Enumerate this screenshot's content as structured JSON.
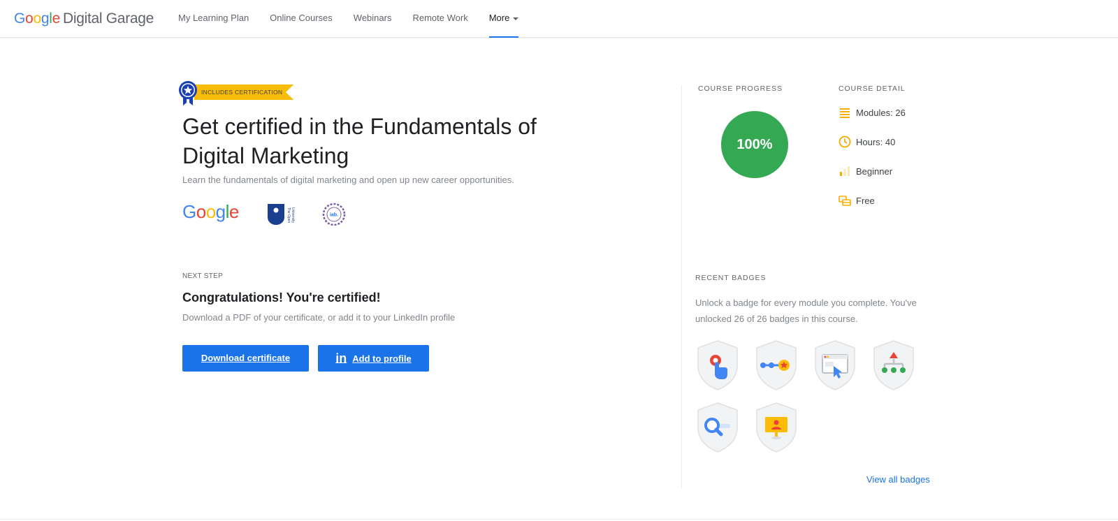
{
  "header": {
    "logo_google": "Google",
    "logo_rest": "Digital Garage",
    "nav": [
      {
        "label": "My Learning Plan"
      },
      {
        "label": "Online Courses"
      },
      {
        "label": "Webinars"
      },
      {
        "label": "Remote Work"
      },
      {
        "label": "More"
      }
    ]
  },
  "course": {
    "certification_ribbon": "INCLUDES CERTIFICATION",
    "title": "Get certified in the Fundamentals of Digital Marketing",
    "subtitle": "Learn the fundamentals of digital marketing and open up new career opportunities.",
    "partners": {
      "google": "Google",
      "open_university": "The Open University",
      "iab": "iab."
    }
  },
  "next_step": {
    "label": "NEXT STEP",
    "heading": "Congratulations! You're certified!",
    "description": "Download a PDF of your certificate, or add it to your LinkedIn profile",
    "download_button": "Download certificate",
    "profile_button_icon": "in",
    "profile_button": "Add to profile"
  },
  "progress": {
    "label": "COURSE PROGRESS",
    "value_text": "100%",
    "value": 100,
    "color": "#34a853"
  },
  "details": {
    "label": "COURSE DETAIL",
    "modules": "Modules: 26",
    "hours": "Hours: 40",
    "level": "Beginner",
    "price": "Free",
    "icon_color": "#f9ab00"
  },
  "badges": {
    "label": "RECENT BADGES",
    "description": "Unlock a badge for every module you complete. You've unlocked 26 of 26 badges in this course.",
    "view_all": "View all badges",
    "items": [
      {
        "icon": "pointer-click-badge-icon"
      },
      {
        "icon": "path-star-badge-icon"
      },
      {
        "icon": "browser-cursor-badge-icon"
      },
      {
        "icon": "hierarchy-badge-icon"
      },
      {
        "icon": "search-badge-icon"
      },
      {
        "icon": "presentation-badge-icon"
      }
    ]
  },
  "colors": {
    "brand_blue": "#1a73e8",
    "ribbon_yellow": "#fbbc05",
    "success_green": "#34a853"
  }
}
